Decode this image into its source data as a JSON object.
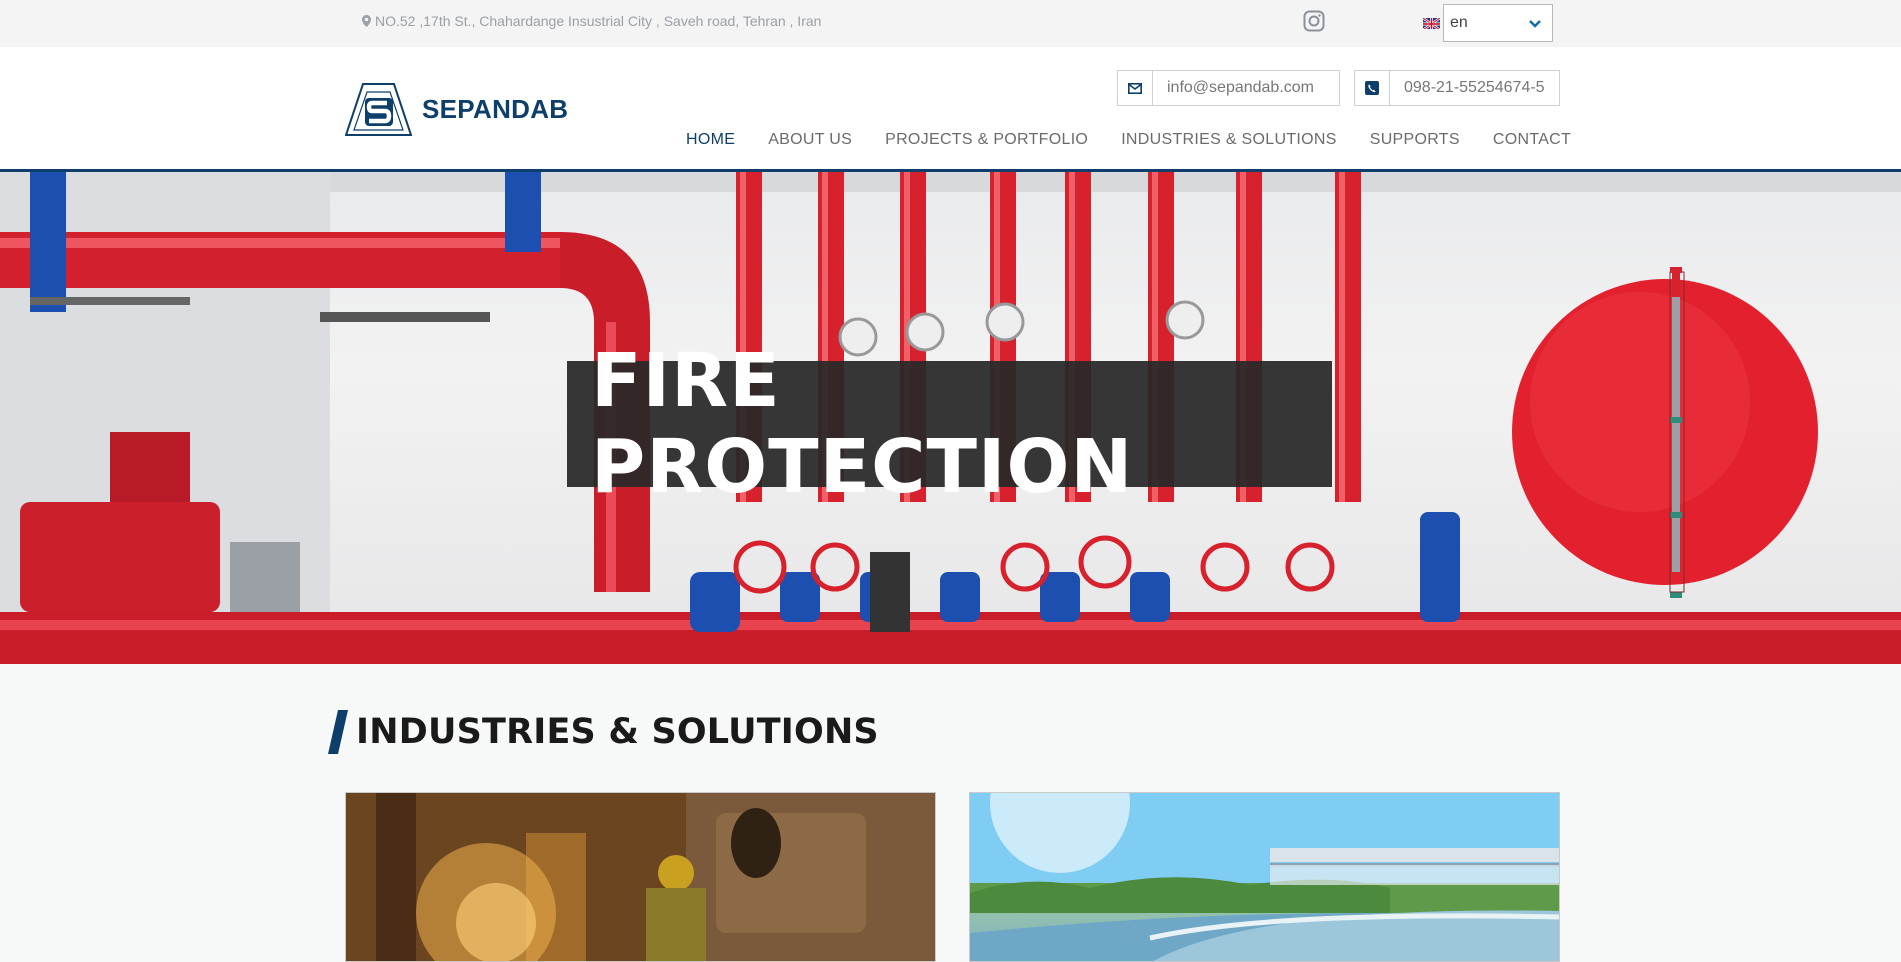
{
  "topbar": {
    "address": "NO.52 ,17th St., Chahardange Insustrial City , Saveh road, Tehran , Iran",
    "social_icon": "instagram-icon",
    "language": "en"
  },
  "header": {
    "brand": "SEPANDAB",
    "email": "info@sepandab.com",
    "phone": "098-21-55254674-5",
    "nav": [
      {
        "label": "HOME",
        "active": true
      },
      {
        "label": "ABOUT US",
        "active": false
      },
      {
        "label": "PROJECTS & PORTFOLIO",
        "active": false
      },
      {
        "label": "INDUSTRIES & SOLUTIONS",
        "active": false
      },
      {
        "label": "SUPPORTS",
        "active": false
      },
      {
        "label": "CONTACT",
        "active": false
      }
    ]
  },
  "hero": {
    "title": "FIRE PROTECTION"
  },
  "section": {
    "title": "INDUSTRIES & SOLUTIONS"
  },
  "colors": {
    "brand": "#0e3f6b",
    "pipe_red": "#d9202c",
    "valve_blue": "#1d4fb0"
  }
}
